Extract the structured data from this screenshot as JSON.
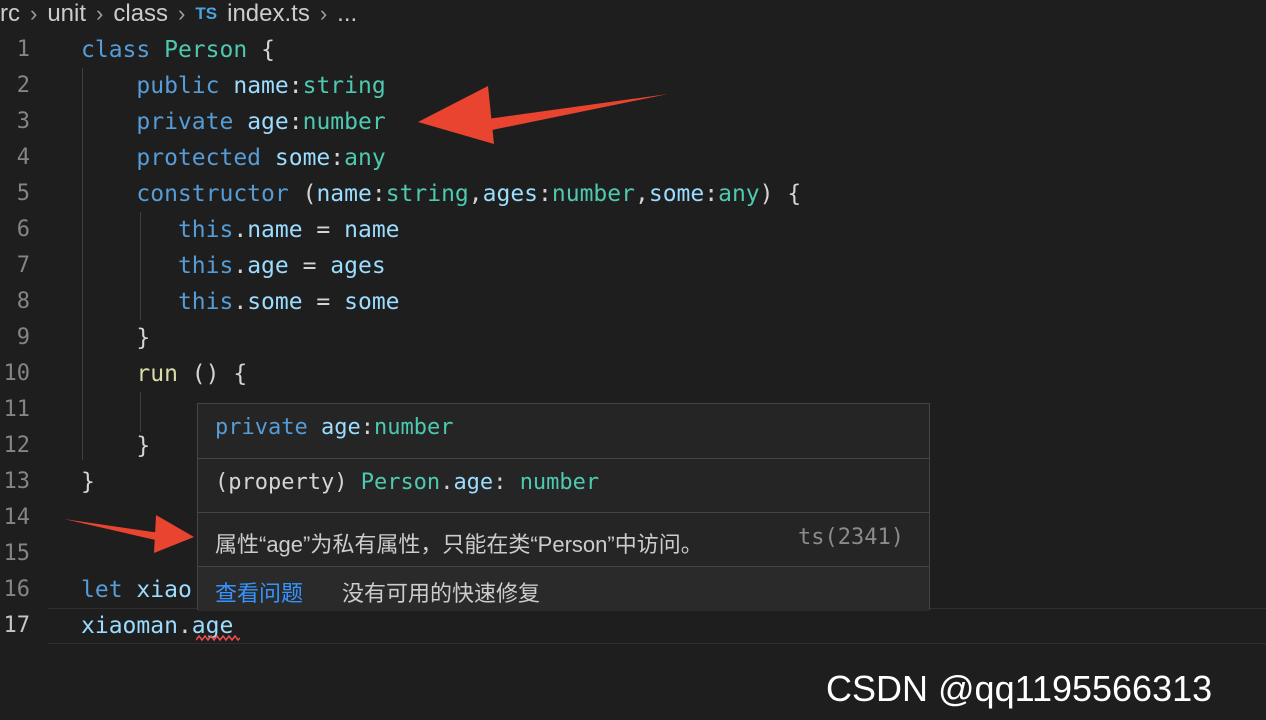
{
  "breadcrumb": {
    "items": [
      "rc",
      "unit",
      "class",
      "index.ts",
      "..."
    ],
    "ts_badge": "TS"
  },
  "editor": {
    "line_numbers": [
      "1",
      "2",
      "3",
      "4",
      "5",
      "6",
      "7",
      "8",
      "9",
      "10",
      "11",
      "12",
      "13",
      "14",
      "15",
      "16",
      "17"
    ],
    "active_line": "17",
    "tokens": {
      "l1": [
        "class",
        "Person",
        "{"
      ],
      "l2": [
        "public",
        "name",
        ":",
        "string"
      ],
      "l3": [
        "private",
        "age",
        ":",
        "number"
      ],
      "l4": [
        "protected",
        "some",
        ":",
        "any"
      ],
      "l5": [
        "constructor",
        "(",
        "name",
        ":",
        "string",
        ",",
        "ages",
        ":",
        "number",
        ",",
        "some",
        ":",
        "any",
        ") {"
      ],
      "l6": [
        "this",
        ".",
        "name",
        " = ",
        "name"
      ],
      "l7": [
        "this",
        ".",
        "age",
        " = ",
        "ages"
      ],
      "l8": [
        "this",
        ".",
        "some",
        " = ",
        "some"
      ],
      "l9": [
        "}"
      ],
      "l10": [
        "run",
        " () {"
      ],
      "l12": [
        "}"
      ],
      "l13": [
        "}"
      ],
      "l16": [
        "let",
        "xiao"
      ],
      "l17": [
        "xiaoman",
        ".",
        "age"
      ]
    },
    "error_marker": "squiggle-error"
  },
  "hover": {
    "signature": [
      "private",
      "age",
      ":",
      "number"
    ],
    "property": [
      "(property)",
      "Person",
      ".",
      "age",
      ":",
      "number"
    ],
    "error_message": "属性“age”为私有属性，只能在类“Person”中访问。",
    "error_code": "ts(2341)",
    "view_problem": "查看问题",
    "no_quick_fix": "没有可用的快速修复"
  },
  "annotations": {
    "arrow_color": "#e8442f"
  },
  "watermark": {
    "text": "CSDN @qq1195566313"
  }
}
